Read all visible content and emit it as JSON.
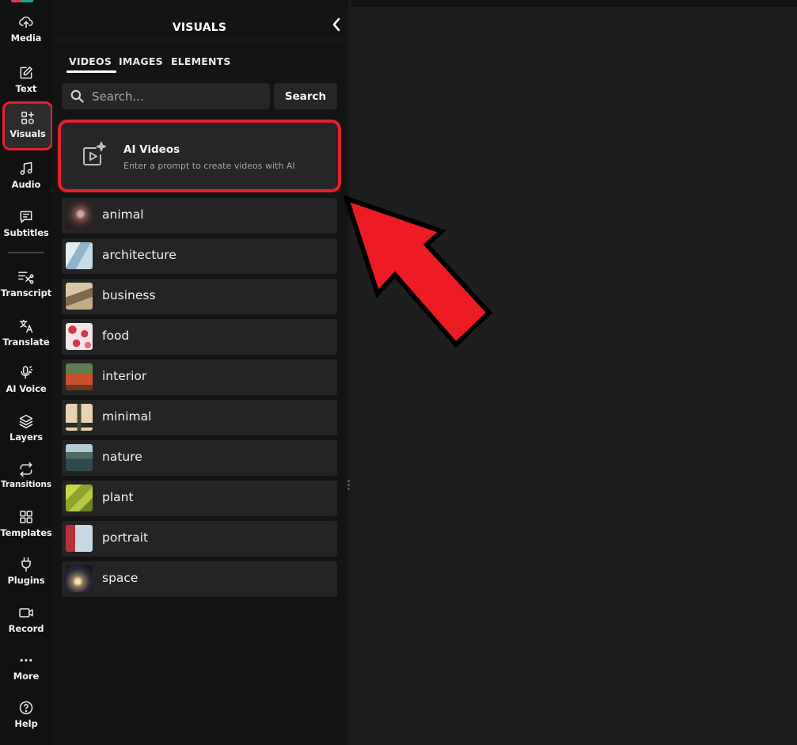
{
  "rail": {
    "items": [
      {
        "label": "Media",
        "icon": "upload-icon"
      },
      {
        "label": "Text",
        "icon": "pencil-edit-icon"
      },
      {
        "label": "Visuals",
        "icon": "shapes-plus-icon",
        "active": true
      },
      {
        "label": "Audio",
        "icon": "music-note-icon"
      },
      {
        "label": "Subtitles",
        "icon": "subtitles-icon"
      },
      {
        "label": "Transcript",
        "icon": "transcript-icon"
      },
      {
        "label": "Translate",
        "icon": "translate-icon"
      },
      {
        "label": "AI Voice",
        "icon": "microphone-icon"
      },
      {
        "label": "Layers",
        "icon": "layers-icon"
      },
      {
        "label": "Transitions",
        "icon": "transitions-icon"
      },
      {
        "label": "Templates",
        "icon": "grid-icon"
      },
      {
        "label": "Plugins",
        "icon": "plug-icon"
      },
      {
        "label": "Record",
        "icon": "video-camera-icon"
      },
      {
        "label": "More",
        "icon": "ellipsis-icon"
      },
      {
        "label": "Help",
        "icon": "help-circle-icon"
      }
    ]
  },
  "panel": {
    "title": "VISUALS",
    "tabs": [
      "VIDEOS",
      "IMAGES",
      "ELEMENTS"
    ],
    "active_tab": "VIDEOS",
    "search": {
      "placeholder": "Search...",
      "value": "",
      "button": "Search"
    },
    "ai_card": {
      "title": "AI Videos",
      "subtitle": "Enter a prompt to create videos with AI"
    },
    "categories": [
      {
        "label": "animal"
      },
      {
        "label": "architecture"
      },
      {
        "label": "business"
      },
      {
        "label": "food"
      },
      {
        "label": "interior"
      },
      {
        "label": "minimal"
      },
      {
        "label": "nature"
      },
      {
        "label": "plant"
      },
      {
        "label": "portrait"
      },
      {
        "label": "space"
      }
    ]
  },
  "colors": {
    "highlight": "#e5202e",
    "background": "#1e1e1e",
    "panel": "#141414",
    "rail": "#111111"
  }
}
